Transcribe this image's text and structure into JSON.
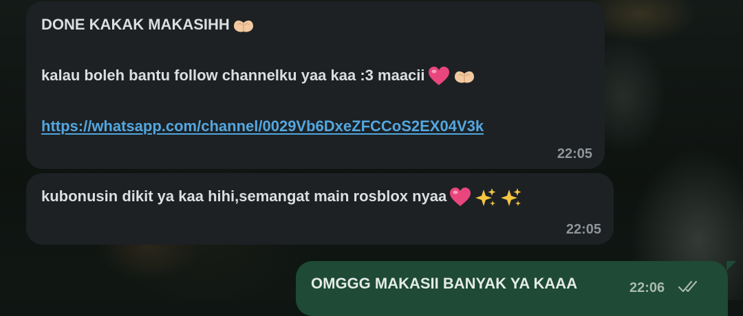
{
  "messages": [
    {
      "direction": "incoming",
      "lines": {
        "l1": "DONE KAKAK MAKASIHH",
        "l2": "kalau boleh bantu follow channelku yaa kaa :3 maacii",
        "link": "https://whatsapp.com/channel/0029Vb6DxeZFCCoS2EX04V3k"
      },
      "time": "22:05",
      "emojis": [
        "heart-hands-emoji",
        "pink-heart-emoji",
        "heart-hands-emoji"
      ]
    },
    {
      "direction": "incoming",
      "text": "kubonusin dikit ya kaa hihi,semangat main rosblox nyaa",
      "time": "22:05",
      "emojis": [
        "pink-heart-emoji",
        "sparkles-emoji",
        "sparkles-emoji"
      ]
    },
    {
      "direction": "outgoing",
      "text": "OMGGG MAKASII BANYAK YA KAAA",
      "time": "22:06",
      "status": "read-double-check-icon"
    }
  ],
  "colors": {
    "incoming_bubble": "#1d2124",
    "outgoing_bubble": "#1e4a36",
    "link": "#53a7e0",
    "text": "#dcdedf",
    "timestamp": "#8f9598"
  }
}
